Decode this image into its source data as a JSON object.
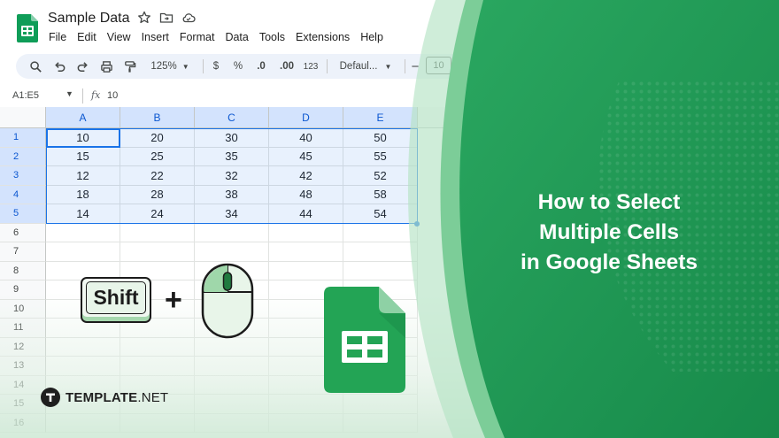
{
  "app": {
    "title": "Sample Data",
    "menu": [
      "File",
      "Edit",
      "View",
      "Insert",
      "Format",
      "Data",
      "Tools",
      "Extensions",
      "Help"
    ]
  },
  "toolbar": {
    "zoom": "125%",
    "currency": "$",
    "percent": "%",
    "decrease_decimal": ".0",
    "increase_decimal": ".00",
    "number_format": "123",
    "font": "Defaul...",
    "minus": "−",
    "font_size": "10"
  },
  "formula_bar": {
    "range": "A1:E5",
    "fx": "fx",
    "value": "10"
  },
  "sheet": {
    "columns": [
      "A",
      "B",
      "C",
      "D",
      "E"
    ],
    "rows": [
      "1",
      "2",
      "3",
      "4",
      "5",
      "6",
      "7",
      "8",
      "9",
      "10",
      "11",
      "12",
      "13",
      "14",
      "15",
      "16"
    ],
    "selected_rows": 5,
    "data": [
      [
        "10",
        "20",
        "30",
        "40",
        "50"
      ],
      [
        "15",
        "25",
        "35",
        "45",
        "55"
      ],
      [
        "12",
        "22",
        "32",
        "42",
        "52"
      ],
      [
        "18",
        "28",
        "38",
        "48",
        "58"
      ],
      [
        "14",
        "24",
        "34",
        "44",
        "54"
      ]
    ]
  },
  "illustration": {
    "key_label": "Shift",
    "plus": "+"
  },
  "headline": {
    "line1": "How to Select",
    "line2": "Multiple Cells",
    "line3": "in Google Sheets"
  },
  "brand": {
    "name": "TEMPLATE",
    "suffix": ".NET"
  },
  "colors": {
    "accent_green": "#23a455",
    "panel_green": "#1f9a55",
    "selection_blue": "#1a73e8",
    "header_blue": "#d3e3fd"
  }
}
